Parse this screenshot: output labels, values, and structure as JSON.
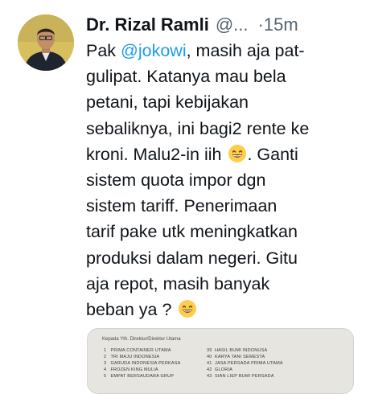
{
  "author": {
    "name": "Dr. Rizal Ramli",
    "handle": "@...",
    "separator": "·",
    "time": "15m"
  },
  "tweet": {
    "lines": [
      [
        "Pak ",
        "@jokowi",
        ", masih aja pat-"
      ],
      [
        "gulipat. Katanya mau bela"
      ],
      [
        "petani, tapi kebijakan"
      ],
      [
        "sebaliknya, ini bagi2 rente ke"
      ],
      [
        "kroni. Malu2-in iih ",
        "😄",
        ". Ganti"
      ],
      [
        "sistem quota impor dgn"
      ],
      [
        "sistem tariff. Penerimaan"
      ],
      [
        "tarif pake utk meningkatkan"
      ],
      [
        "produksi dalam negeri. Gitu"
      ],
      [
        "aja repot, masih banyak"
      ],
      [
        "beban ya ? ",
        "😄"
      ]
    ]
  },
  "media": {
    "header": "Kepada Yth. Direktur/Direktur Utama",
    "left_rows": [
      [
        "1",
        "PRIMA CONTAINER UTAMA"
      ],
      [
        "2",
        "TRI MAJU INDONESIA"
      ],
      [
        "3",
        "GARUDA INDONESIA PERKASA"
      ],
      [
        "4",
        "FROZEN KING MULIA"
      ],
      [
        "5",
        "EMPAT BERSAUDARA GRUP"
      ]
    ],
    "right_rows": [
      [
        "39",
        "HASIL BUMI INDONUSA"
      ],
      [
        "40",
        "KARYA TANI SEMESTA"
      ],
      [
        "41",
        "JASA PERSADA PRIMA UTAMA"
      ],
      [
        "42",
        "GLORIA"
      ],
      [
        "43",
        "SIAN LIEP BUMI PERSADA"
      ]
    ]
  },
  "colors": {
    "mention": "#1d9bf0",
    "secondary_text": "#536471",
    "primary_text": "#0f1419"
  }
}
